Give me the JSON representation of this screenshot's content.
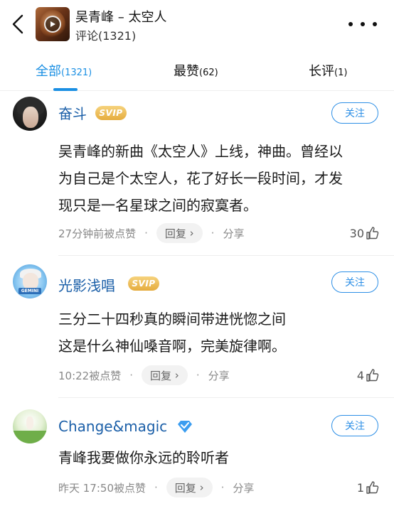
{
  "header": {
    "song_title": "吴青峰 – 太空人",
    "comment_count": "评论(1321)"
  },
  "tabs": [
    {
      "label": "全部",
      "count": "(1321)",
      "active": true
    },
    {
      "label": "最赞",
      "count": "(62)",
      "active": false
    },
    {
      "label": "长评",
      "count": "(1)",
      "active": false
    }
  ],
  "colors": {
    "accent": "#1a8fe3",
    "username": "#1b5fa8",
    "svip_gold": "#e5ac3e"
  },
  "follow_label": "关注",
  "reply_label": "回复",
  "share_label": "分享",
  "comments": [
    {
      "user": "奋斗",
      "badge": "SVIP",
      "text_lines": [
        "吴青峰的新曲《太空人》上线，神曲。曾经以",
        "为自己是个太空人，花了好长一段时间，才发",
        "现只是一名星球之间的寂寞者。"
      ],
      "time": "27分钟前被点赞",
      "likes": "30"
    },
    {
      "user": "光影浅唱",
      "badge": "SVIP",
      "avatar_tag": "GEMINI",
      "text_lines": [
        "三分二十四秒真的瞬间带进恍惚之间",
        "这是什么神仙嗓音啊，完美旋律啊。"
      ],
      "time": "10:22被点赞",
      "likes": "4"
    },
    {
      "user": "Change&magic",
      "badge_icon": "verified-diamond-icon",
      "text_lines": [
        "青峰我要做你永远的聆听者"
      ],
      "time": "昨天 17:50被点赞",
      "likes": "1"
    }
  ]
}
